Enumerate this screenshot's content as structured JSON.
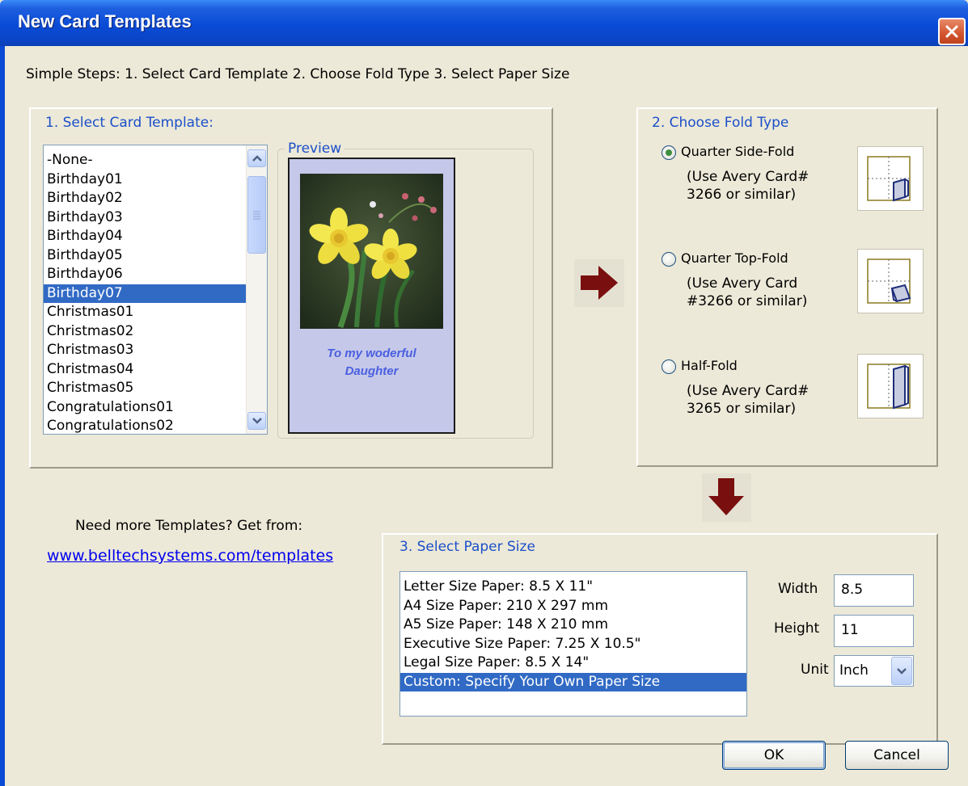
{
  "window": {
    "title": "New Card Templates"
  },
  "steps_text": "Simple Steps: 1. Select Card Template  2. Choose Fold Type  3. Select Paper Size",
  "template_group": {
    "legend": "1. Select Card Template:",
    "items": [
      "-None-",
      "Birthday01",
      "Birthday02",
      "Birthday03",
      "Birthday04",
      "Birthday05",
      "Birthday06",
      "Birthday07",
      "Christmas01",
      "Christmas02",
      "Christmas03",
      "Christmas04",
      "Christmas05",
      "Congratulations01",
      "Congratulations02"
    ],
    "selected": "Birthday07",
    "preview_legend": "Preview",
    "preview_caption": [
      "To my woderful",
      "Daughter"
    ]
  },
  "fold_group": {
    "legend": "2. Choose Fold Type",
    "options": [
      {
        "label": "Quarter Side-Fold",
        "desc": [
          "(Use Avery Card#",
          "3266 or similar)"
        ],
        "checked": true
      },
      {
        "label": "Quarter Top-Fold",
        "desc": [
          "(Use Avery Card",
          "#3266 or similar)"
        ],
        "checked": false
      },
      {
        "label": "Half-Fold",
        "desc": [
          "(Use Avery Card#",
          "3265 or similar)"
        ],
        "checked": false
      }
    ]
  },
  "more_templates": {
    "text": "Need more Templates? Get from:",
    "link": "www.belltechsystems.com/templates"
  },
  "paper_group": {
    "legend": "3. Select Paper Size",
    "items": [
      "Letter Size Paper: 8.5 X 11\"",
      "A4 Size Paper: 210   X 297 mm",
      "A5 Size Paper: 148   X 210 mm",
      "Executive Size Paper: 7.25   X 10.5\"",
      "Legal Size Paper: 8.5 X 14\"",
      "Custom: Specify Your Own Paper Size"
    ],
    "selected": "Custom: Specify Your Own Paper Size",
    "width_label": "Width",
    "width_value": "8.5",
    "height_label": "Height",
    "height_value": "11",
    "unit_label": "Unit",
    "unit_value": "Inch"
  },
  "buttons": {
    "ok": "OK",
    "cancel": "Cancel"
  },
  "colors": {
    "accent_arrow": "#7A0F0F",
    "selection": "#316AC5",
    "legend_text": "#1C4FC9"
  }
}
